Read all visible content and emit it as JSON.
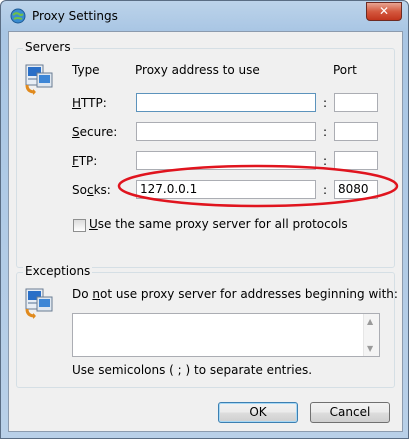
{
  "window": {
    "title": "Proxy Settings",
    "close_glyph": "✕"
  },
  "servers": {
    "group_label": "Servers",
    "col_type": "Type",
    "col_address": "Proxy address to use",
    "col_port": "Port",
    "rows": [
      {
        "label_pre": "",
        "label_key": "H",
        "label_post": "TTP:",
        "address": "",
        "port": ""
      },
      {
        "label_pre": "",
        "label_key": "S",
        "label_post": "ecure:",
        "address": "",
        "port": ""
      },
      {
        "label_pre": "",
        "label_key": "F",
        "label_post": "TP:",
        "address": "",
        "port": ""
      },
      {
        "label_pre": "So",
        "label_key": "c",
        "label_post": "ks:",
        "address": "127.0.0.1",
        "port": "8080"
      }
    ],
    "colon": ":",
    "same_proxy_key": "U",
    "same_proxy_rest": "se the same proxy server for all protocols",
    "same_proxy_checked": false
  },
  "exceptions": {
    "group_label": "Exceptions",
    "desc_pre": "Do ",
    "desc_key": "n",
    "desc_post": "ot use proxy server for addresses beginning with:",
    "value": "",
    "hint": "Use semicolons ( ; ) to separate entries."
  },
  "buttons": {
    "ok": "OK",
    "cancel": "Cancel"
  },
  "icons": {
    "window": "internet-options-icon",
    "network": "network-computer-icon"
  },
  "colors": {
    "annotation": "#e0141e",
    "accent": "#3c7fb1"
  }
}
